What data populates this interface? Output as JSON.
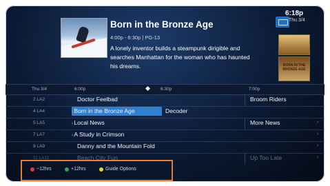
{
  "header": {
    "title": "Born in the Bronze Age",
    "meta": "4:00p - 6:30p | PG-13",
    "description": "A lonely inventor builds a steampunk dirigible and searches Manhattan for the woman who has haunted his dreams."
  },
  "status": {
    "time": "6:18p",
    "date": "Thu 3/4"
  },
  "posters": {
    "second_title": "BORN IN THE BRONZE AGE"
  },
  "timebar": {
    "date": "Thu 3/4",
    "t1": "6:00p",
    "t2": "6:30p",
    "t3": "7:00p"
  },
  "rows": [
    {
      "channel": "2 LA2",
      "prog1": "Doctor Feelbad",
      "prog2": "Broom Riders"
    },
    {
      "channel": "4 LA4",
      "prog1": "Born in the Bronze Age",
      "prog2": "Decoder"
    },
    {
      "channel": "5 LA5",
      "prog1": "Local News",
      "prog2": "More News"
    },
    {
      "channel": "7 LA7",
      "prog1": "A Study in Crimson"
    },
    {
      "channel": "9 LA9",
      "prog1": "Danny and the Mountain Fold"
    },
    {
      "channel": "11 LA11",
      "prog1": "Beach City Fun",
      "prog2": "Up Too Late"
    }
  ],
  "legend": {
    "red": "−12hrs",
    "green": "+12hrs",
    "yellow": "Guide Options"
  },
  "colors": {
    "accent": "#2f7fd3",
    "highlight_border": "#ef7b2a",
    "red": "#e03a3a",
    "green": "#2ea84a",
    "yellow": "#e8d23a"
  }
}
